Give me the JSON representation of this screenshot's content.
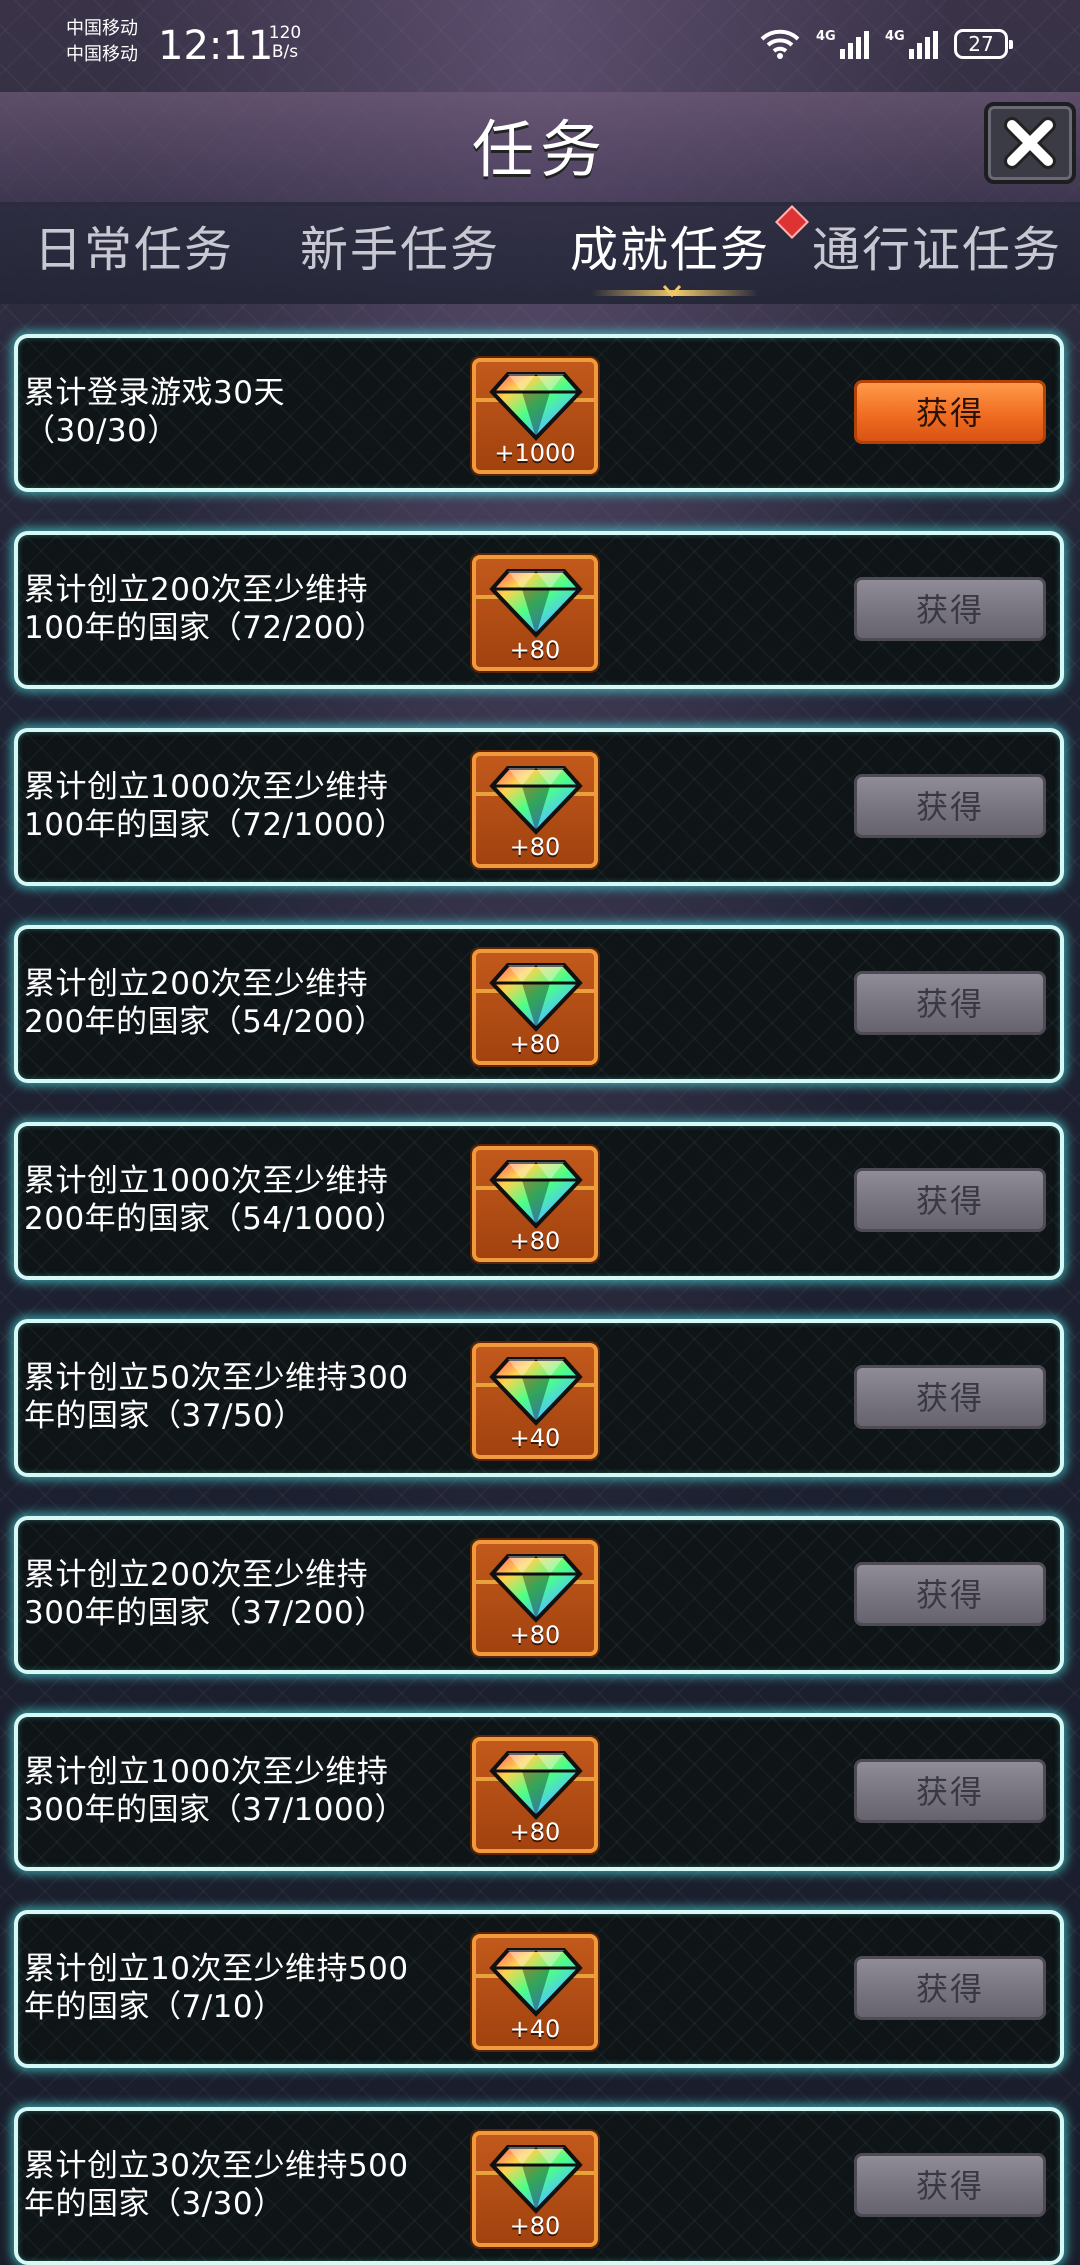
{
  "status_bar": {
    "carrier_1": "中国移动",
    "carrier_2": "中国移动",
    "time": "12:11",
    "net_speed_value": "120",
    "net_speed_unit": "B/s",
    "signal_1_label": "4G",
    "signal_2_label": "4G",
    "battery": "27"
  },
  "header": {
    "title": "任务"
  },
  "tabs": [
    {
      "label": "日常任务",
      "active": false
    },
    {
      "label": "新手任务",
      "active": false
    },
    {
      "label": "成就任务",
      "active": true
    },
    {
      "label": "通行证任务",
      "active": false
    }
  ],
  "tasks": [
    {
      "line1": "累计登录游戏30天",
      "line2": "（30/30）",
      "reward": "+1000",
      "button": "获得",
      "claimable": true
    },
    {
      "line1": "累计创立200次至少维持",
      "line2": "100年的国家（72/200）",
      "reward": "+80",
      "button": "获得",
      "claimable": false
    },
    {
      "line1": "累计创立1000次至少维持",
      "line2": "100年的国家（72/1000）",
      "reward": "+80",
      "button": "获得",
      "claimable": false
    },
    {
      "line1": "累计创立200次至少维持",
      "line2": "200年的国家（54/200）",
      "reward": "+80",
      "button": "获得",
      "claimable": false
    },
    {
      "line1": "累计创立1000次至少维持",
      "line2": "200年的国家（54/1000）",
      "reward": "+80",
      "button": "获得",
      "claimable": false
    },
    {
      "line1": "累计创立50次至少维持300",
      "line2": "年的国家（37/50）",
      "reward": "+40",
      "button": "获得",
      "claimable": false
    },
    {
      "line1": "累计创立200次至少维持",
      "line2": "300年的国家（37/200）",
      "reward": "+80",
      "button": "获得",
      "claimable": false
    },
    {
      "line1": "累计创立1000次至少维持",
      "line2": "300年的国家（37/1000）",
      "reward": "+80",
      "button": "获得",
      "claimable": false
    },
    {
      "line1": "累计创立10次至少维持500",
      "line2": "年的国家（7/10）",
      "reward": "+40",
      "button": "获得",
      "claimable": false
    },
    {
      "line1": "累计创立30次至少维持500",
      "line2": "年的国家（3/30）",
      "reward": "+80",
      "button": "获得",
      "claimable": false
    }
  ],
  "colors": {
    "card_border_glow": "#46dcdc",
    "button_active": "#f06d22",
    "button_disabled": "#77747f",
    "reward_frame": "#c2591c"
  }
}
